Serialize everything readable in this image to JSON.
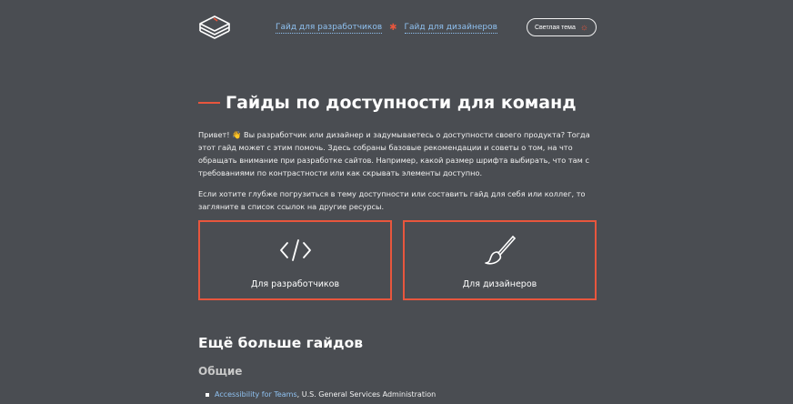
{
  "header": {
    "logo": "book-stack-logo",
    "nav": [
      {
        "label": "Гайд для разработчиков"
      },
      {
        "label": "Гайд для дизайнеров"
      }
    ],
    "nav_separator": "✱",
    "theme_button": {
      "label": "Светлая тема",
      "icon": "sun-icon"
    }
  },
  "main": {
    "title": "Гайды по доступности для команд",
    "intro": "Привет! 👋 Вы разработчик или дизайнер и задумываетесь о доступности своего продукта? Тогда этот гайд может с этим помочь. Здесь собраны базовые рекомендации и советы о том, на что обращать внимание при разработке сайтов. Например, какой размер шрифта выбирать, что там с требованиями по контрастности или как скрывать элементы доступно.",
    "more": "Если хотите глубже погрузиться в тему доступности или составить гайд для себя или коллег, то загляните в список ссылок на другие ресурсы.",
    "cards": [
      {
        "label": "Для разработчиков",
        "icon": "code-icon"
      },
      {
        "label": "Для дизайнеров",
        "icon": "brush-icon"
      }
    ],
    "more_guides_title": "Ещё больше гайдов",
    "general_title": "Общие",
    "links": [
      {
        "link_text": "Accessibility for Teams",
        "suffix": ", U.S. General Services Administration"
      }
    ]
  },
  "colors": {
    "background": "#4a4d52",
    "accent": "#e8563d",
    "link": "#8fc1f0"
  }
}
